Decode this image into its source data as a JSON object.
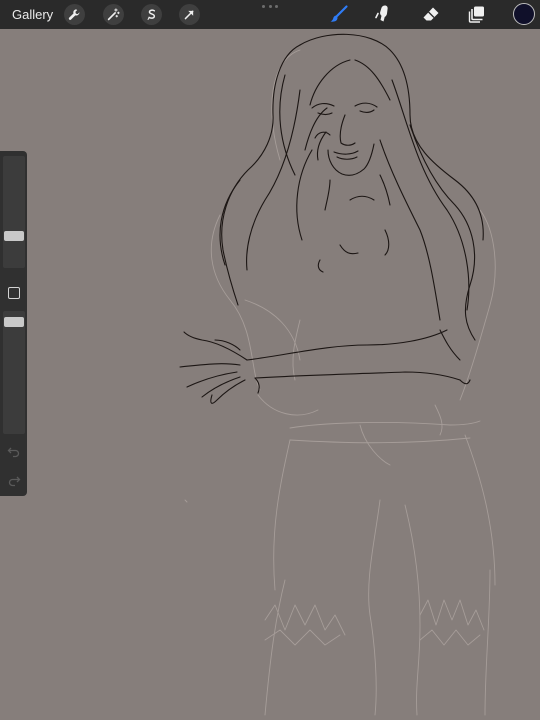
{
  "toolbar": {
    "gallery_label": "Gallery",
    "left_tools": [
      {
        "name": "actions-wrench-icon"
      },
      {
        "name": "adjustments-magic-wand-icon"
      },
      {
        "name": "selection-s-icon"
      },
      {
        "name": "transform-arrow-icon"
      }
    ],
    "right_tools": [
      {
        "name": "brush-icon",
        "active": true,
        "color": "#2f7cf6"
      },
      {
        "name": "smudge-icon"
      },
      {
        "name": "eraser-icon"
      },
      {
        "name": "layers-icon"
      }
    ],
    "current_color": "#10102a"
  },
  "sidebar": {
    "brush_size": 0.26,
    "brush_opacity": 0.95,
    "undo_icon": "undo-arrow-icon",
    "redo_icon": "redo-arrow-icon"
  },
  "canvas": {
    "background": "#867e7b",
    "ink_color": "#1c1614",
    "sketch_color": "#a69d99"
  }
}
